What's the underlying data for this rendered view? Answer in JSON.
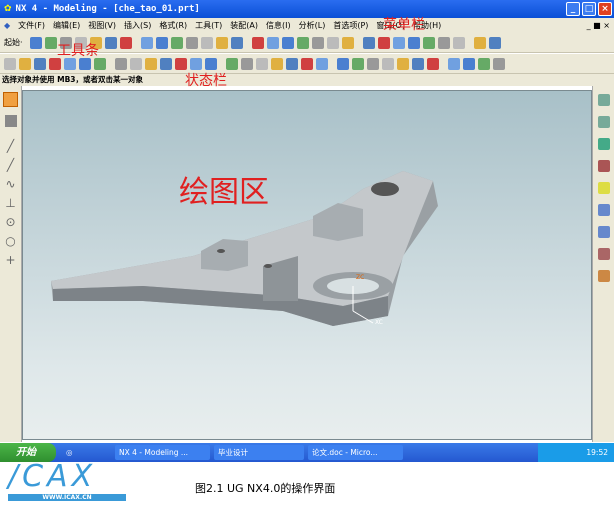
{
  "window": {
    "title": "NX 4 - Modeling - [che_tao_01.prt]",
    "min": "_",
    "max": "□",
    "close": "×"
  },
  "menu": {
    "items": [
      "文件(F)",
      "编辑(E)",
      "视图(V)",
      "插入(S)",
      "格式(R)",
      "工具(T)",
      "装配(A)",
      "信息(I)",
      "分析(L)",
      "首选项(P)",
      "窗口(O)",
      "帮助(H)"
    ],
    "right": "_ ■ ×"
  },
  "toolbar": {
    "start_label": "起始·"
  },
  "status": {
    "prompt": "选择对象并使用 MB3，或者双击某一对象"
  },
  "annotations": {
    "menubar": "菜单栏",
    "toolbar": "工具条",
    "statusbar": "状态栏",
    "drawing_area": "绘图区"
  },
  "viewport": {
    "axis_label": "XC",
    "axis_label2": "ZC"
  },
  "taskbar": {
    "start": "开始",
    "tasks": [
      "NX 4 - Modeling ...",
      "毕业设计",
      "论文.doc - Micro..."
    ],
    "clock": "19:52"
  },
  "logo": {
    "text": "ICAX",
    "url_text": "WWW.ICAX.CN"
  },
  "caption": "图2.1 UG NX4.0的操作界面",
  "colors": {
    "title": "#0a4fd6",
    "annotation": "#e02020"
  }
}
